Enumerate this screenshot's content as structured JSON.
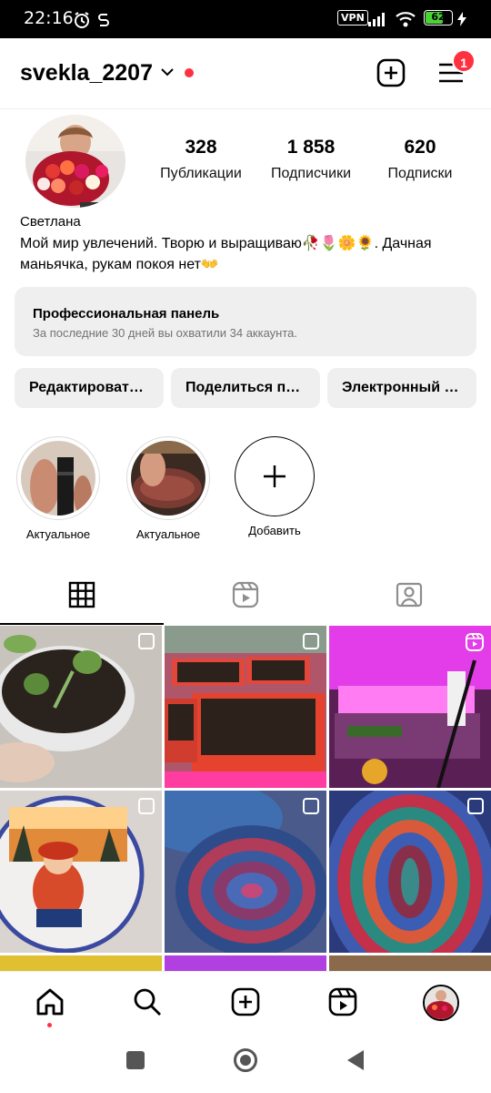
{
  "status_bar": {
    "time": "22:16",
    "vpn": "VPN",
    "battery": "62",
    "battery_level": 0.62
  },
  "header": {
    "username": "svekla_2207",
    "menu_badge": "1"
  },
  "profile": {
    "stats": [
      {
        "value": "328",
        "label": "Публикации"
      },
      {
        "value": "1 858",
        "label": "Подписчики"
      },
      {
        "value": "620",
        "label": "Подписки"
      }
    ],
    "name": "Светлана",
    "bio": "Мой мир увлечений. Творю и выращиваю🥀🌷🌼🌻. Дачная маньячка, рукам покоя нет👐"
  },
  "pro_panel": {
    "title": "Профессиональная панель",
    "subtitle": "За последние 30 дней вы охватили 34 аккаунта."
  },
  "actions": [
    "Редактироват…",
    "Поделиться п…",
    "Электронный …"
  ],
  "highlights": [
    {
      "label": "Актуальное"
    },
    {
      "label": "Актуальное"
    },
    {
      "label": "Добавить"
    }
  ],
  "tabs": [
    "grid-icon",
    "reels-icon",
    "tagged-icon"
  ],
  "bottom_nav": [
    "home-icon",
    "search-icon",
    "create-icon",
    "reels-icon",
    "profile-avatar"
  ],
  "colors": {
    "accent_red": "#ff3040",
    "panel_gray": "#efefef"
  }
}
